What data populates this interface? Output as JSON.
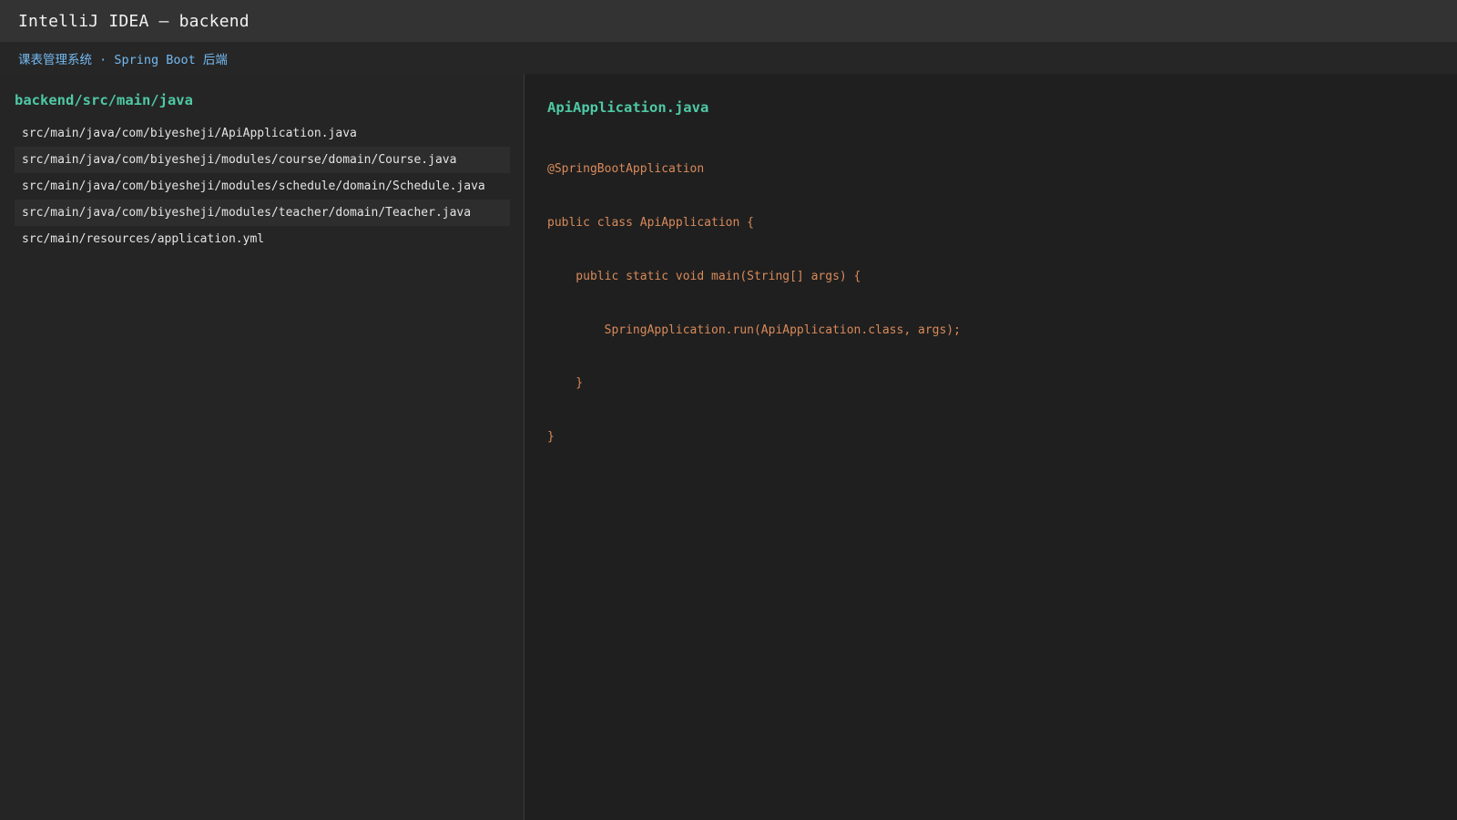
{
  "window": {
    "title": "IntelliJ IDEA — backend"
  },
  "subheader": {
    "text": "课表管理系统 · Spring Boot 后端"
  },
  "sidebar": {
    "heading": "backend/src/main/java",
    "files": [
      "src/main/java/com/biyesheji/ApiApplication.java",
      "src/main/java/com/biyesheji/modules/course/domain/Course.java",
      "src/main/java/com/biyesheji/modules/schedule/domain/Schedule.java",
      "src/main/java/com/biyesheji/modules/teacher/domain/Teacher.java",
      "src/main/resources/application.yml"
    ]
  },
  "editor": {
    "filename": "ApiApplication.java",
    "code_lines": [
      "@SpringBootApplication",
      "public class ApiApplication {",
      "    public static void main(String[] args) {",
      "        SpringApplication.run(ApiApplication.class, args);",
      "    }",
      "}"
    ]
  },
  "colors": {
    "accent": "#4ec9a4",
    "subtitle": "#74b9f0",
    "code": "#d98a5a",
    "background": "#1f1f1f"
  }
}
